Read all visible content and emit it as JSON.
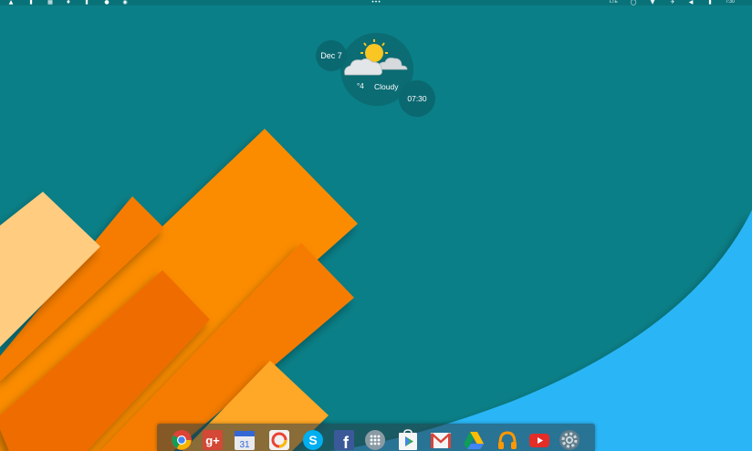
{
  "widget": {
    "date": "Dec 7",
    "temperature": "°4",
    "condition": "Cloudy",
    "time": "07:30"
  },
  "status_bar": {
    "left_icons": [
      "notification-icon",
      "clipboard-icon",
      "gallery-icon",
      "twitter-icon",
      "download-icon",
      "android-icon",
      "settings-icon"
    ],
    "right_icons": [
      "lte-indicator",
      "alarm-icon",
      "wifi-icon",
      "airplane-icon",
      "volume-icon",
      "battery-icon"
    ],
    "network": "LTE",
    "clock": "7:30"
  },
  "dock": {
    "apps": [
      "Chrome",
      "Google+",
      "Calendar",
      "Photos",
      "Skype",
      "Facebook",
      "All apps",
      "Play Store",
      "Gmail",
      "Drive",
      "Play Music",
      "YouTube",
      "Settings"
    ],
    "calendar_day": "31"
  },
  "colors": {
    "background": "#0b7f87",
    "accent_blue": "#29b6f6",
    "orange": "#fb8c00",
    "light_orange": "#ffcc80"
  }
}
